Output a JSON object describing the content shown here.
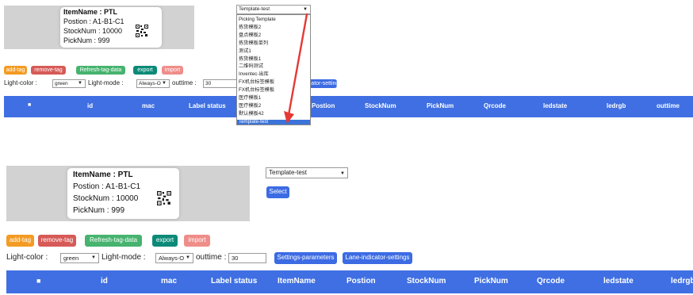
{
  "label_preview": {
    "item_name": "ItemName : PTL",
    "position": "Postion : A1-B1-C1",
    "stock": "StockNum : 10000",
    "pick": "PickNum : 999",
    "qr_icon": "qr-code"
  },
  "template_select": {
    "value": "Template-test",
    "caret": "▼",
    "options": [
      "Picking Template",
      "拣货模板2",
      "盘点模板2",
      "拣货模板单列",
      "测试1",
      "拣货模板1",
      "二维码测试",
      "Inventec-出库",
      "FX机台标签模板",
      "FX机台标签模板",
      "医疗模板1",
      "医疗模板2",
      "默认模板42",
      "Template-test"
    ]
  },
  "toolbar": {
    "add_tag": "add-tag",
    "remove_tag": "remove-tag",
    "refresh_tag_data": "Refresh-tag-data",
    "export": "export",
    "import": "import",
    "select": "Select"
  },
  "controls": {
    "light_color_label": "Light-color :",
    "light_color_value": "green",
    "light_mode_label": "Light-mode :",
    "light_mode_value": "Always-O",
    "outtime_label": "outtime :",
    "outtime_value": "30",
    "settings_parameters": "Settings-parameters",
    "lane_indicator_settings": "Lane-indicator-settings"
  },
  "table_headers": {
    "checkbox": "■",
    "id": "id",
    "mac": "mac",
    "label_status": "Label status",
    "item_name": "ItemName",
    "position": "Postion",
    "stock": "StockNum",
    "pick": "PickNum",
    "qrcode": "Qrcode",
    "ledstate": "ledstate",
    "ledrgb": "ledrgb",
    "outtime": "outtime"
  },
  "colors": {
    "table_header": "#3f6fe2",
    "arrow": "#e53935",
    "dropdown_highlight": "#3c73d9"
  },
  "annotation": {
    "arrow": "red-arrow-pointer"
  }
}
